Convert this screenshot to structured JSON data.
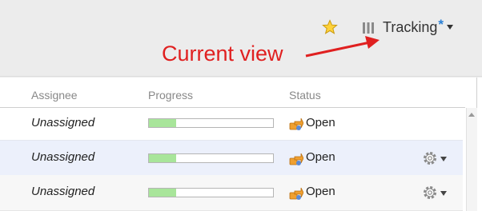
{
  "toolbar": {
    "view_name": "Tracking",
    "modified_marker": "*",
    "icons": [
      "star-icon",
      "columns-icon",
      "chevron-down-icon"
    ]
  },
  "annotation": {
    "label": "Current view",
    "color": "#e02020"
  },
  "table": {
    "columns": [
      "Assignee",
      "Progress",
      "Status"
    ],
    "rows": [
      {
        "assignee": "Unassigned",
        "progress": 0.22,
        "status": "Open",
        "has_actions": false
      },
      {
        "assignee": "Unassigned",
        "progress": 0.22,
        "status": "Open",
        "has_actions": true
      },
      {
        "assignee": "Unassigned",
        "progress": 0.22,
        "status": "Open",
        "has_actions": true
      }
    ]
  },
  "colors": {
    "progress_fill": "#a8e59a",
    "selected_row": "#ecf0fb",
    "modified_marker": "#2a7fd4"
  }
}
